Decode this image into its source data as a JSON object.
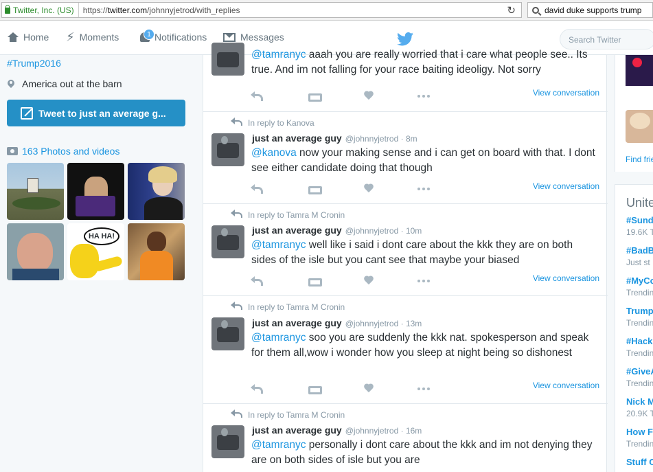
{
  "browser": {
    "site_identity": "Twitter, Inc. (US)",
    "url_prefix": "https://",
    "url_domain": "twitter.com",
    "url_path": "/johnnyjetrod/with_replies",
    "search_value": "david duke supports trump"
  },
  "nav": {
    "home": "Home",
    "moments": "Moments",
    "notifications": "Notifications",
    "notifications_count": "1",
    "messages": "Messages",
    "search_placeholder": "Search Twitter"
  },
  "profile": {
    "hashtag": "#Trump2016",
    "location": "America out at the barn",
    "tweet_button": "Tweet to just an average g...",
    "photos_link": "163 Photos and videos"
  },
  "tweets": [
    {
      "mention": "@tamranyc",
      "text": " aaah you are really worried that i care what people see.. Its true. And im not falling for your race baiting ideoligy. Not sorry",
      "view": "View conversation"
    },
    {
      "reply_to": "In reply to Kanova",
      "name": "just an average guy",
      "handle": "@johnnyjetrod · 8m",
      "mention": "@kanova",
      "text": " now your making sense and i can get on board with that. I dont see either candidate doing that though",
      "view": "View conversation"
    },
    {
      "reply_to": "In reply to Tamra M Cronin",
      "name": "just an average guy",
      "handle": "@johnnyjetrod · 10m",
      "mention": "@tamranyc",
      "text": " well like i said i dont care about the kkk they are on both sides of the isle but you cant see that maybe your biased",
      "view": "View conversation"
    },
    {
      "reply_to": "In reply to Tamra M Cronin",
      "name": "just an average guy",
      "handle": "@johnnyjetrod · 13m",
      "mention": "@tamranyc",
      "text": " soo you are suddenly the kkk nat. spokesperson and speak for them all,wow i wonder how you sleep at night being so dishonest",
      "view": "View conversation"
    },
    {
      "reply_to": "In reply to Tamra M Cronin",
      "name": "just an average guy",
      "handle": "@johnnyjetrod · 16m",
      "mention": "@tamranyc",
      "text": " personally i dont care about the kkk and im not denying they are on both sides of isle but you are"
    }
  ],
  "right": {
    "find_friends": "Find frie",
    "trends_title": "Unite",
    "trends": [
      {
        "name": "#Sund",
        "sub": "19.6K T"
      },
      {
        "name": "#BadB",
        "sub": "Just st"
      },
      {
        "name": "#MyCo",
        "sub": "Trendin"
      },
      {
        "name": "Trump",
        "sub": "Trendin"
      },
      {
        "name": "#Hackl",
        "sub": "Trendin"
      },
      {
        "name": "#GiveA",
        "sub": "Trendin"
      },
      {
        "name": "Nick M",
        "sub": "20.9K T"
      },
      {
        "name": "How F",
        "sub": "Trendin"
      },
      {
        "name": "Stuff C",
        "sub": ""
      }
    ]
  },
  "colors": {
    "accent": "#1b95e0",
    "tweet_button": "#2590c6",
    "secure_green": "#2c8c2c"
  }
}
